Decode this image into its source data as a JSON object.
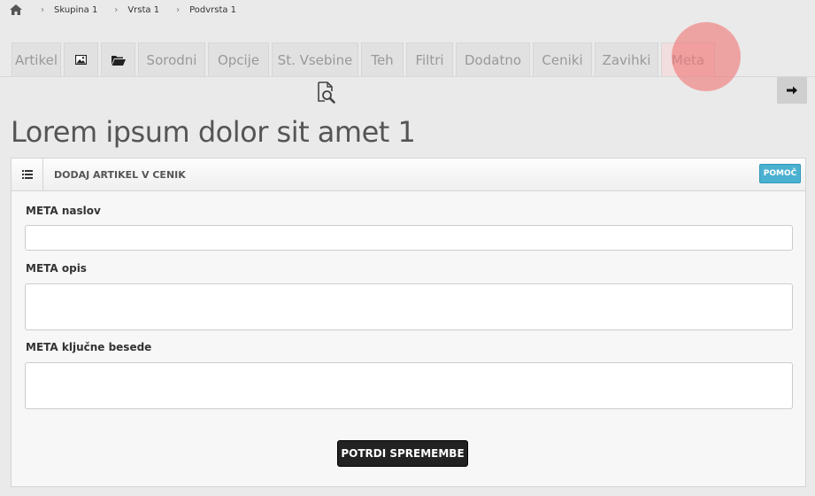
{
  "breadcrumb": {
    "items": [
      "Skupina 1",
      "Vrsta 1",
      "Podvrsta 1"
    ]
  },
  "tabs": [
    {
      "label": "Artikel",
      "icon": null
    },
    {
      "label": "",
      "icon": "image-icon"
    },
    {
      "label": "",
      "icon": "folder-open-icon"
    },
    {
      "label": "Sorodni",
      "icon": null
    },
    {
      "label": "Opcije",
      "icon": null
    },
    {
      "label": "St. Vsebine",
      "icon": null
    },
    {
      "label": "Teh",
      "icon": null
    },
    {
      "label": "Filtri",
      "icon": null
    },
    {
      "label": "Dodatno",
      "icon": null
    },
    {
      "label": "Ceniki",
      "icon": null
    },
    {
      "label": "Zavihki",
      "icon": null
    },
    {
      "label": "Meta",
      "icon": null
    }
  ],
  "active_tab": "Meta",
  "page_title": "Lorem ipsum dolor sit amet 1",
  "panel": {
    "title": "DODAJ ARTIKEL V CENIK",
    "help_label": "POMOČ"
  },
  "form": {
    "meta_title_label": "META naslov",
    "meta_title_value": "",
    "meta_description_label": "META opis",
    "meta_description_value": "",
    "meta_keywords_label": "META ključne besede",
    "meta_keywords_value": "",
    "submit_label": "POTRDI SPREMEMBE"
  },
  "colors": {
    "background": "#eaeaea",
    "help_button": "#4bb1d1",
    "submit_button": "#222222",
    "highlight": "#f07878"
  }
}
